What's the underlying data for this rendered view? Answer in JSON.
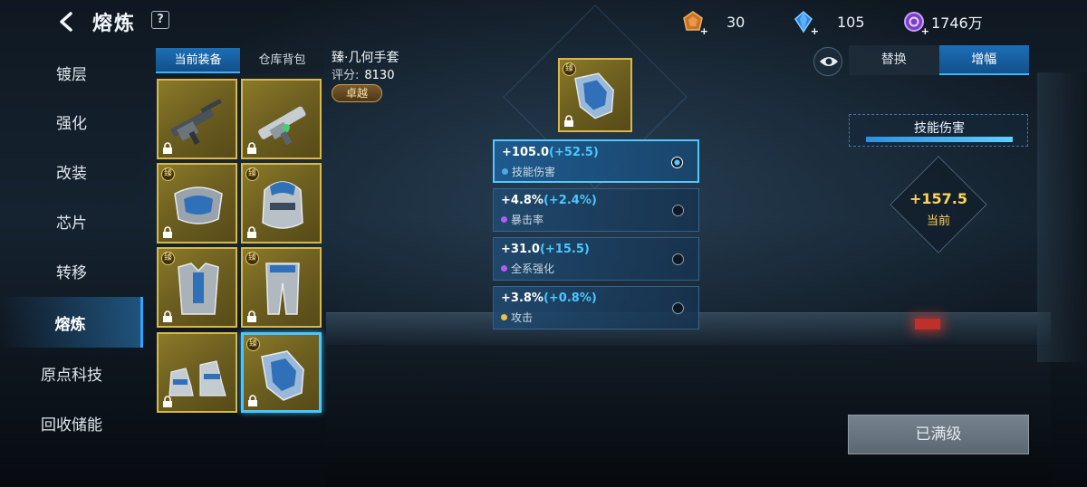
{
  "header": {
    "title": "熔炼",
    "help": "?",
    "currencies": [
      {
        "icon": "ore-icon",
        "value": "30"
      },
      {
        "icon": "crystal-icon",
        "value": "105"
      },
      {
        "icon": "coin-icon",
        "value": "1746万"
      }
    ]
  },
  "sidebar": {
    "items": [
      {
        "label": "镀层"
      },
      {
        "label": "强化"
      },
      {
        "label": "改装"
      },
      {
        "label": "芯片"
      },
      {
        "label": "转移"
      },
      {
        "label": "熔炼",
        "active": true
      },
      {
        "label": "原点科技"
      },
      {
        "label": "回收储能"
      }
    ]
  },
  "equipment": {
    "tabs": [
      {
        "label": "当前装备",
        "active": true
      },
      {
        "label": "仓库背包"
      }
    ],
    "slots": [
      {
        "name": "rifle",
        "badge": ""
      },
      {
        "name": "gun",
        "badge": ""
      },
      {
        "name": "shoulder",
        "badge": "臻"
      },
      {
        "name": "helmet",
        "badge": "臻"
      },
      {
        "name": "armor",
        "badge": "臻"
      },
      {
        "name": "legs",
        "badge": "臻"
      },
      {
        "name": "boots",
        "badge": ""
      },
      {
        "name": "gloves",
        "badge": "臻"
      }
    ]
  },
  "item": {
    "name": "臻·几何手套",
    "score_label": "评分:",
    "score": "8130",
    "rarity": "卓越",
    "badge": "臻"
  },
  "stats": [
    {
      "main": "+105.0",
      "bonus": "(+52.5)",
      "name": "技能伤害",
      "dot_color": "#4aa9e8",
      "selected": true
    },
    {
      "main": "+4.8%",
      "bonus": "(+2.4%)",
      "name": "暴击率",
      "dot_color": "#b25cf0",
      "selected": false
    },
    {
      "main": "+31.0",
      "bonus": "(+15.5)",
      "name": "全系强化",
      "dot_color": "#b25cf0",
      "selected": false
    },
    {
      "main": "+3.8%",
      "bonus": "(+0.8%)",
      "name": "攻击",
      "dot_color": "#f0c040",
      "selected": false
    }
  ],
  "right_panel": {
    "tabs": [
      {
        "label": "替换"
      },
      {
        "label": "增幅",
        "active": true
      }
    ],
    "stat_title": "技能伤害",
    "progress": 1.0,
    "current_value": "+157.5",
    "current_label": "当前",
    "max_button": "已满级"
  }
}
